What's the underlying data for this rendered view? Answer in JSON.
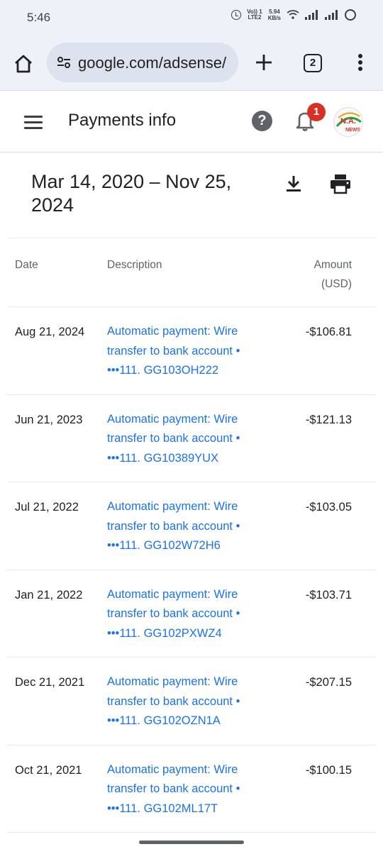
{
  "status_bar": {
    "time": "5:46",
    "volte_top": "Vo)) 1",
    "volte_bottom": "LTE2",
    "speed_value": "5.94",
    "speed_unit": "KB/s"
  },
  "browser": {
    "url": "google.com/adsense/",
    "tab_count": "2"
  },
  "app_bar": {
    "title": "Payments info",
    "help_label": "?",
    "notification_count": "1",
    "avatar_text": "N.A.",
    "avatar_subtext": "NEWS"
  },
  "report": {
    "date_range": "Mar 14, 2020 – Nov 25, 2024"
  },
  "table": {
    "headers": {
      "date": "Date",
      "description": "Description",
      "amount": "Amount",
      "currency": "(USD)"
    },
    "rows": [
      {
        "date": "Aug 21, 2024",
        "line1": "Automatic payment: Wire",
        "line2": "transfer to bank account",
        "line3": "•••111. GG103OH222",
        "amount": "-$106.81"
      },
      {
        "date": "Jun 21, 2023",
        "line1": "Automatic payment: Wire",
        "line2": "transfer to bank account",
        "line3": "•••111. GG10389YUX",
        "amount": "-$121.13"
      },
      {
        "date": "Jul 21, 2022",
        "line1": "Automatic payment: Wire",
        "line2": "transfer to bank account",
        "line3": "•••111. GG102W72H6",
        "amount": "-$103.05"
      },
      {
        "date": "Jan 21, 2022",
        "line1": "Automatic payment: Wire",
        "line2": "transfer to bank account",
        "line3": "•••111. GG102PXWZ4",
        "amount": "-$103.71"
      },
      {
        "date": "Dec 21, 2021",
        "line1": "Automatic payment: Wire",
        "line2": "transfer to bank account",
        "line3": "•••111. GG102OZN1A",
        "amount": "-$207.15"
      },
      {
        "date": "Oct 21, 2021",
        "line1": "Automatic payment: Wire",
        "line2": "transfer to bank account",
        "line3": "•••111. GG102ML17T",
        "amount": "-$100.15"
      }
    ],
    "separator": "•"
  },
  "colors": {
    "link": "#1a73e8",
    "badge": "#d93025",
    "chrome_bar": "#eef1f7"
  }
}
